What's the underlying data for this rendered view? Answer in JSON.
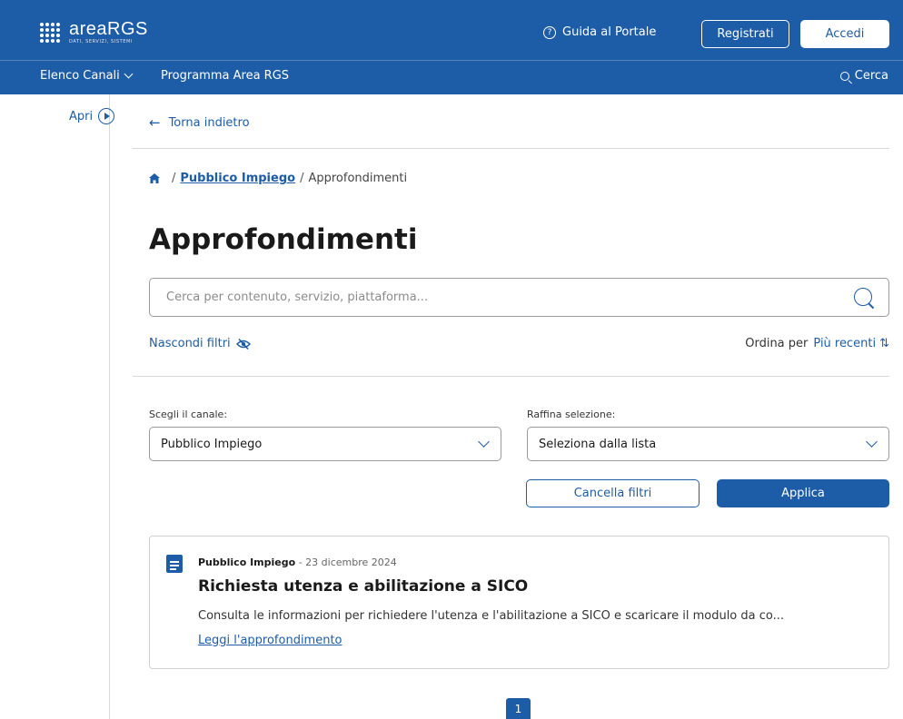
{
  "colors": {
    "primary": "#1d5ca6",
    "border": "#9a9a9a",
    "divider": "#d9d9d9"
  },
  "header": {
    "logo_text": "areaRGS",
    "logo_tagline": "DATI, SERVIZI, SISTEMI",
    "guide_label": "Guida al Portale",
    "register_label": "Registrati",
    "login_label": "Accedi"
  },
  "nav": {
    "channels_label": "Elenco Canali",
    "program_label": "Programma Area RGS",
    "search_label": "Cerca"
  },
  "sidebar": {
    "open_label": "Apri"
  },
  "back_label": "Torna indietro",
  "breadcrumb": {
    "items": [
      "Pubblico Impiego",
      "Approfondimenti"
    ]
  },
  "page_title": "Approfondimenti",
  "search": {
    "placeholder": "Cerca per contenuto, servizio, piattaforma..."
  },
  "filters": {
    "hide_label": "Nascondi filtri",
    "sort_prefix": "Ordina per",
    "sort_value": "Più recenti",
    "channel_label": "Scegli il canale:",
    "channel_value": "Pubblico Impiego",
    "refine_label": "Raffina selezione:",
    "refine_value": "Seleziona dalla lista",
    "clear_label": "Cancella filtri",
    "apply_label": "Applica"
  },
  "results": [
    {
      "channel": "Pubblico Impiego",
      "date": "23 dicembre 2024",
      "title": "Richiesta utenza e abilitazione a SICO",
      "description": "Consulta le informazioni per richiedere l'utenza e l'abilitazione a SICO e scaricare il modulo da co...",
      "link_label": "Leggi l'approfondimento"
    }
  ],
  "pagination": {
    "current_page": "1"
  }
}
